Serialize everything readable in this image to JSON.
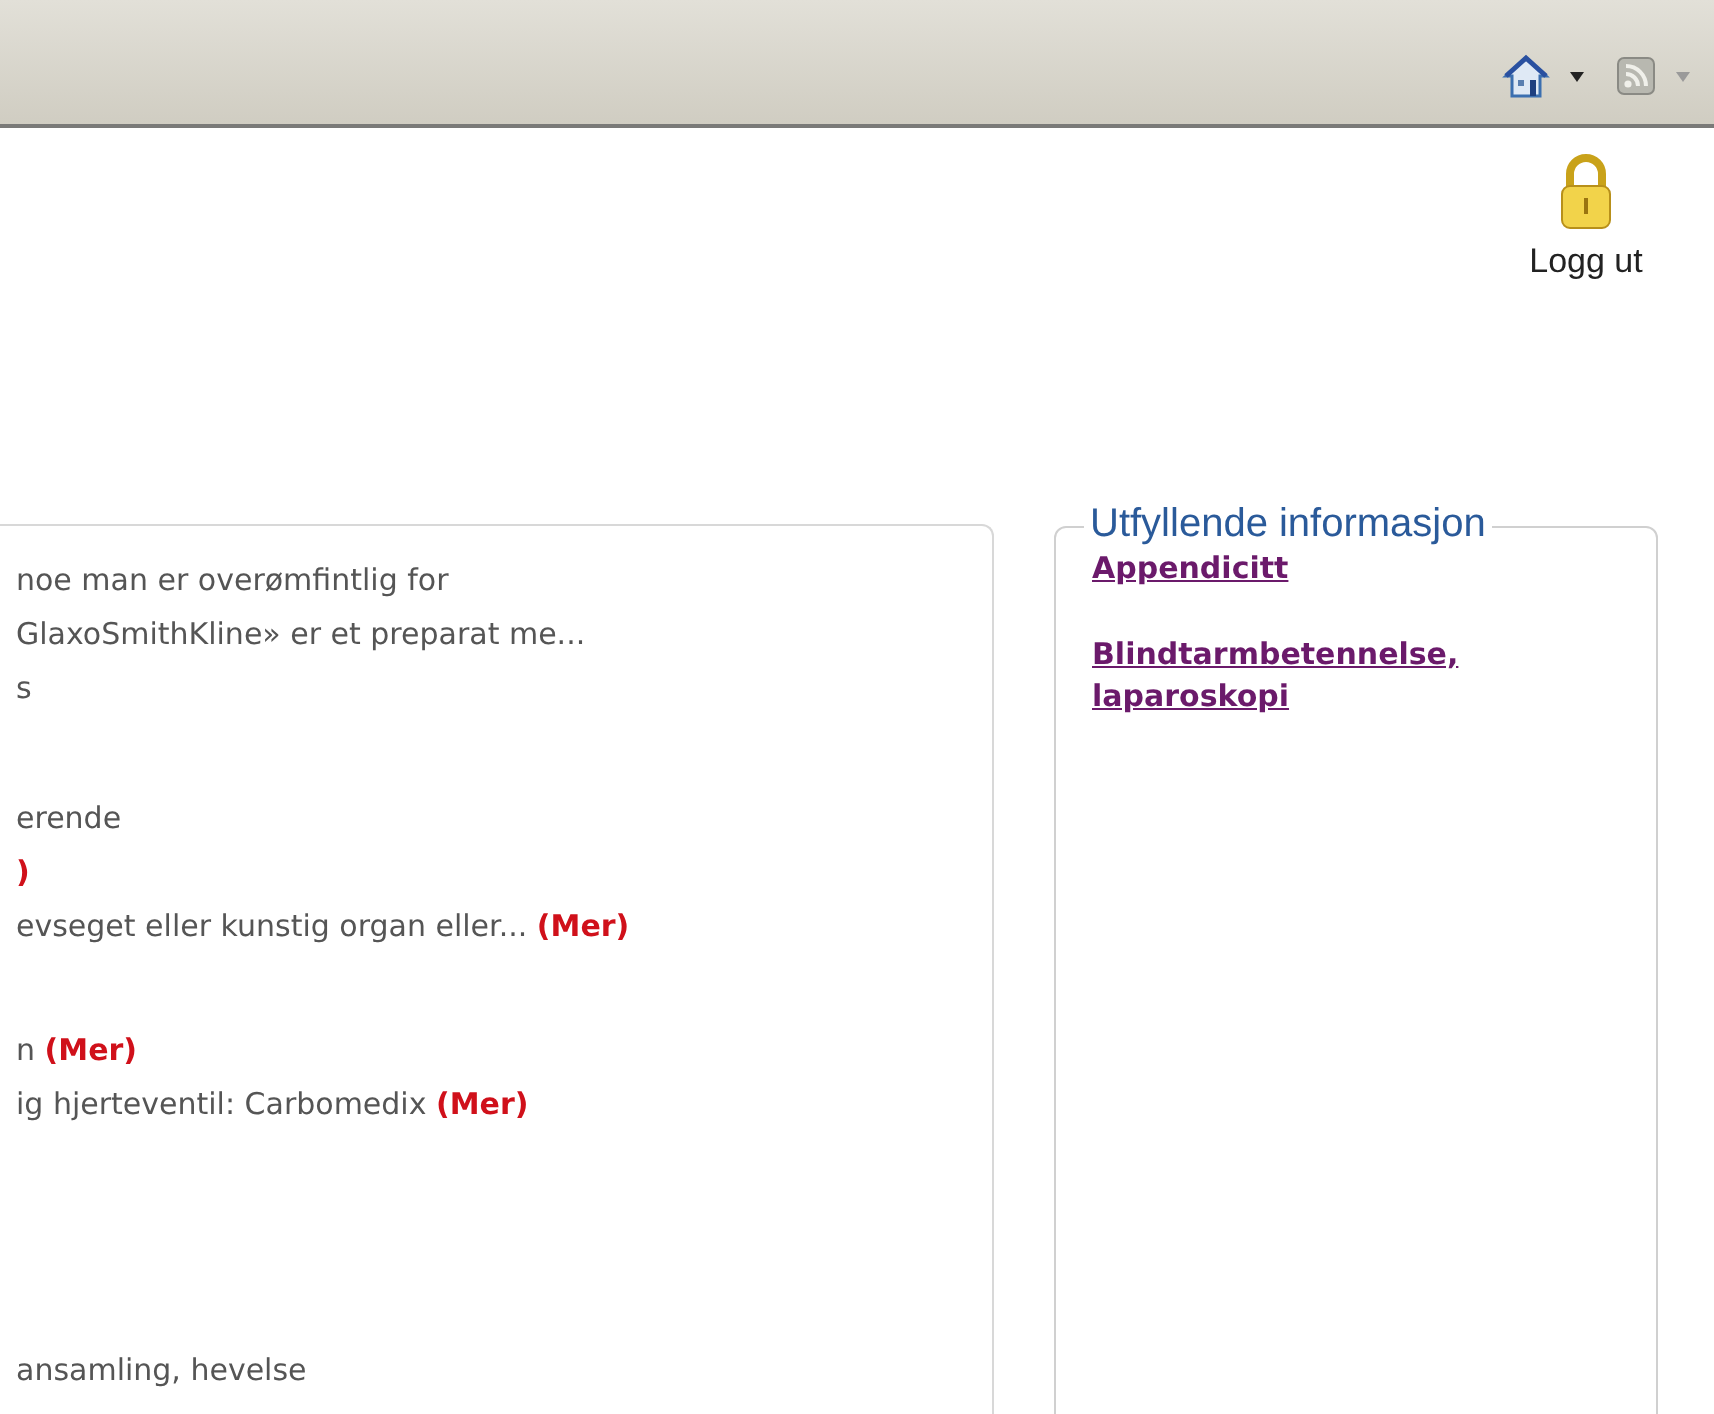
{
  "toolbar": {
    "items": [
      {
        "kind": "home"
      },
      {
        "kind": "feed"
      }
    ]
  },
  "logout": {
    "label": "Logg ut"
  },
  "results": {
    "groups": [
      {
        "lines": [
          {
            "text": "noe man er overømfintlig for"
          },
          {
            "text": "GlaxoSmithKline» er et preparat me..."
          },
          {
            "text": "s"
          }
        ]
      },
      {
        "lines": [
          {
            "text": "erende"
          },
          {
            "more": ")"
          },
          {
            "text": "evseget eller kunstig organ eller...",
            "more": "(Mer)"
          }
        ]
      },
      {
        "lines": [
          {
            "text": "n",
            "more": "(Mer)"
          },
          {
            "text": "ig hjerteventil: Carbomedix",
            "more": "(Mer)"
          }
        ]
      },
      {
        "lines": [
          {
            "text": "ansamling, hevelse"
          }
        ]
      }
    ]
  },
  "info": {
    "title": "Utfyllende informasjon",
    "links": [
      {
        "label": "Appendicitt"
      },
      {
        "label": "Blindtarmbetennelse, laparoskopi"
      }
    ]
  }
}
